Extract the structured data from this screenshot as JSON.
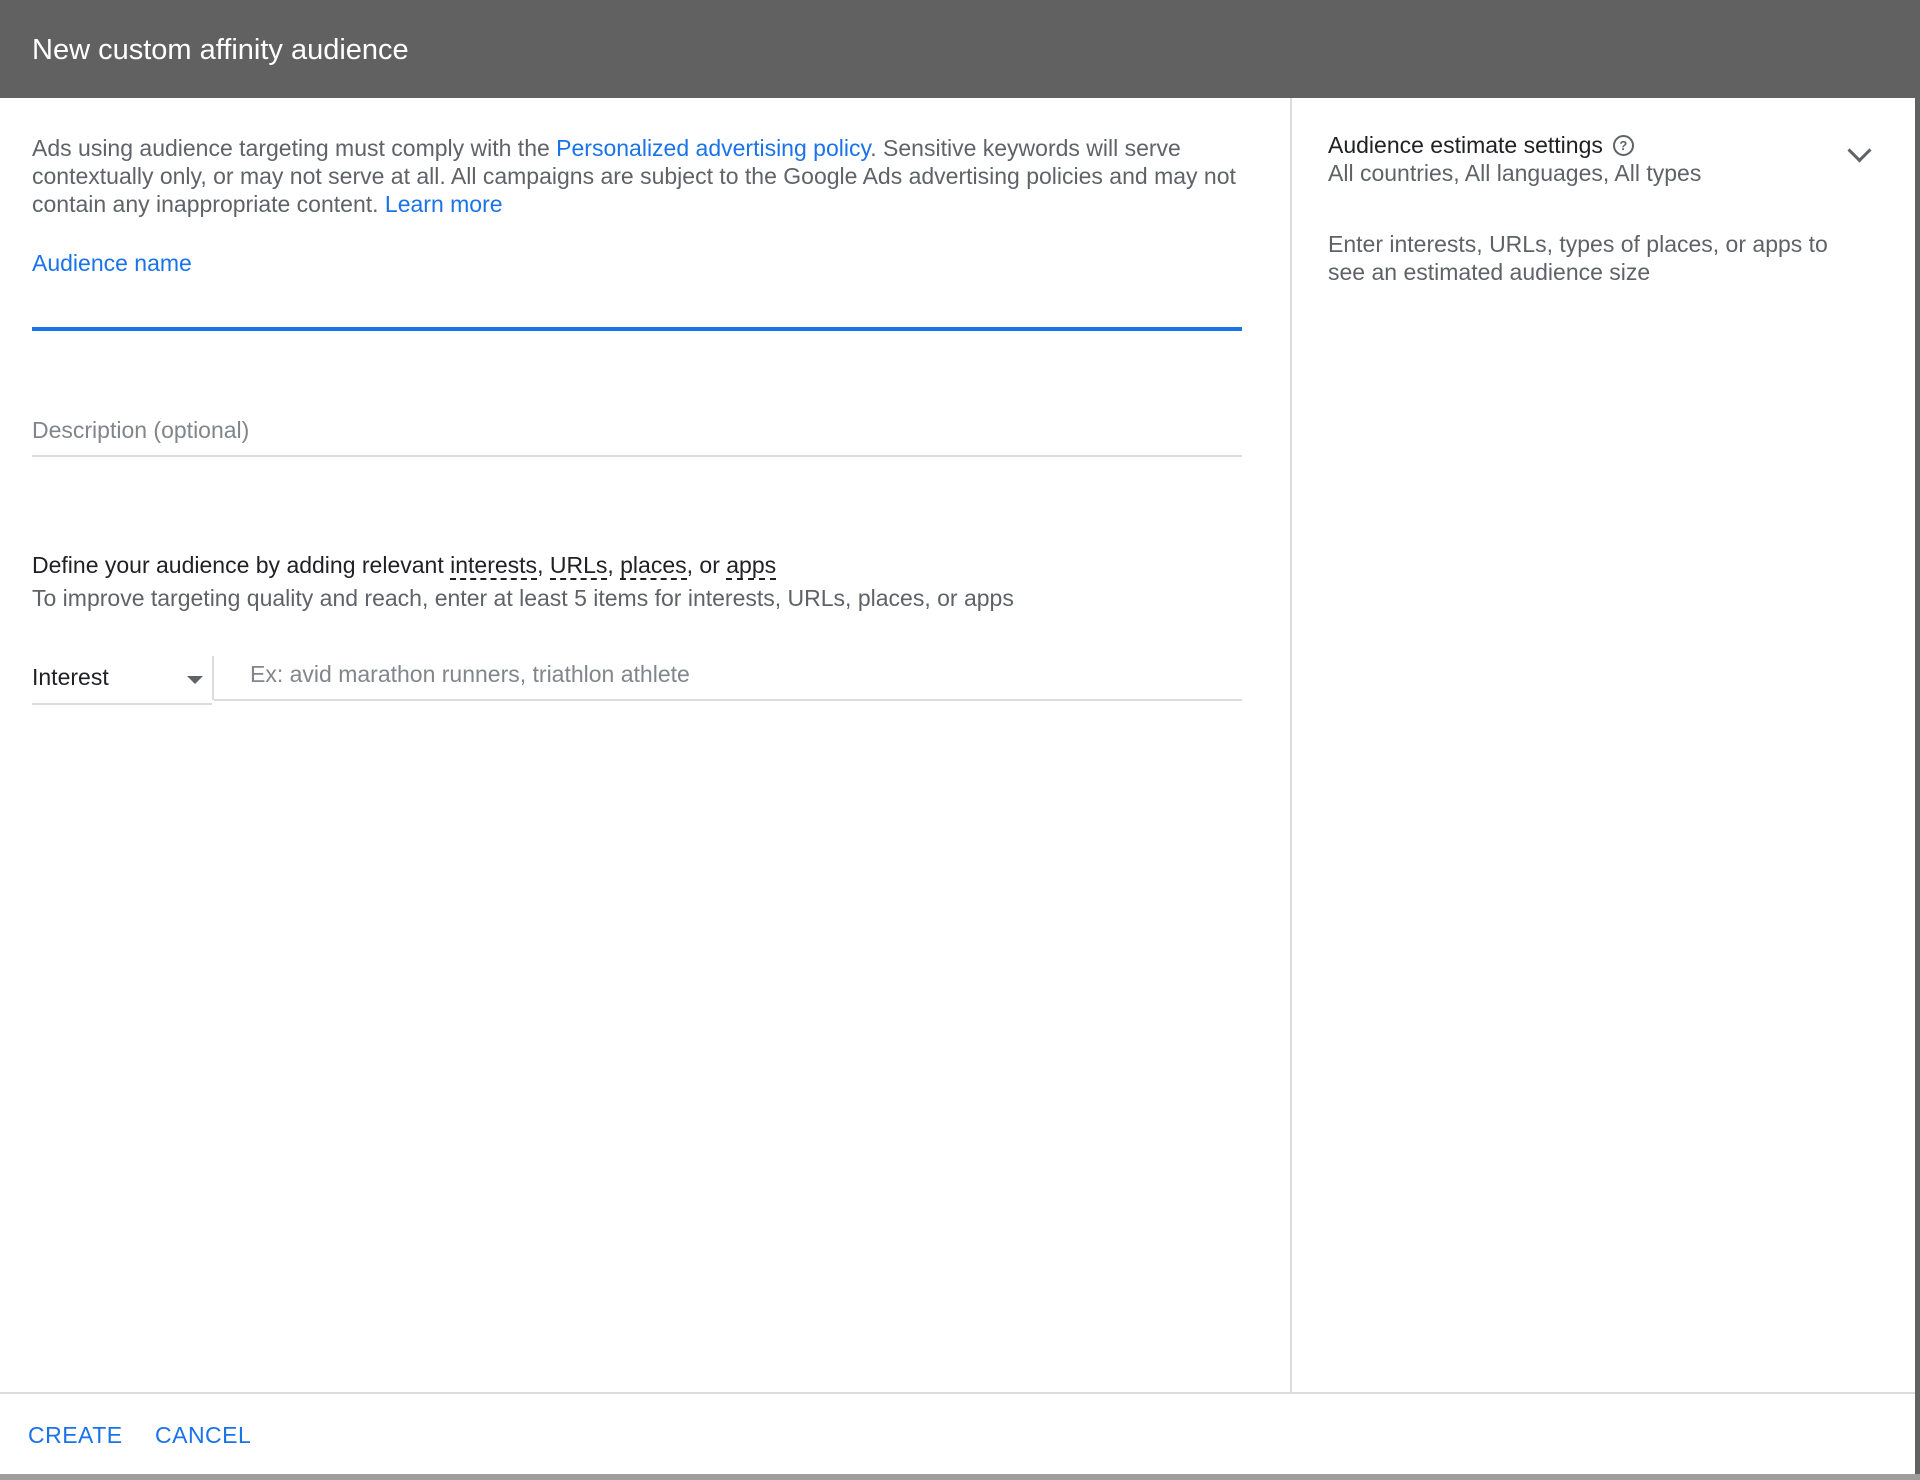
{
  "dialog": {
    "title": "New custom affinity audience"
  },
  "intro": {
    "text_before": "Ads using audience targeting must comply with the ",
    "policy_link": "Personalized advertising policy",
    "text_after": ". Sensitive keywords will serve contextually only, or may not serve at all. All campaigns are subject to the Google Ads advertising policies and may not contain any inappropriate content. ",
    "learn_more": "Learn more"
  },
  "audience_name": {
    "label": "Audience name",
    "value": ""
  },
  "description": {
    "placeholder": "Description (optional)",
    "value": ""
  },
  "define": {
    "prefix": "Define your audience by adding relevant ",
    "interests": "interests",
    "urls": "URLs",
    "places": "places",
    "apps": "apps",
    "comma": ", ",
    "or": ", or ",
    "hint": "To improve targeting quality and reach, enter at least 5 items for interests, URLs, places, or apps"
  },
  "item_entry": {
    "type_selected": "Interest",
    "placeholder": "Ex: avid marathon runners, triathlon athlete"
  },
  "estimate": {
    "title": "Audience estimate settings",
    "help_icon": "?",
    "subtitle": "All countries, All languages, All types",
    "hint": "Enter interests, URLs, types of places, or apps to see an estimated audience size"
  },
  "footer": {
    "create": "CREATE",
    "cancel": "CANCEL"
  },
  "colors": {
    "accent": "#1a73e8",
    "titlebar": "#616161"
  }
}
